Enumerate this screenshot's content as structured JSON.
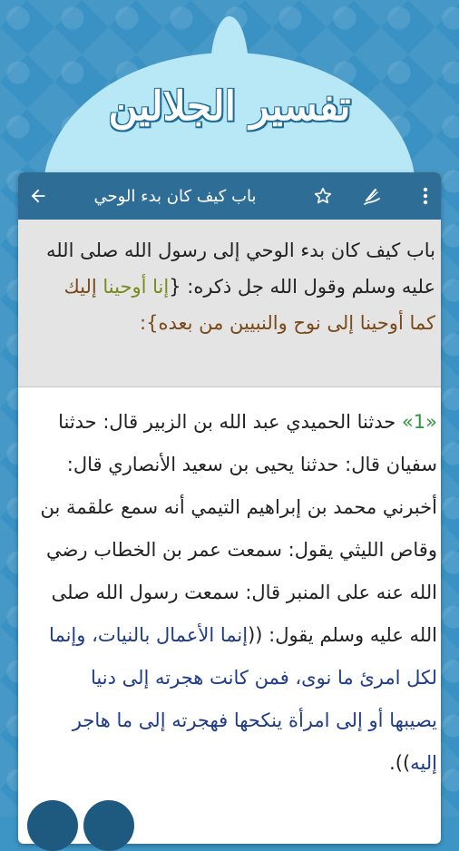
{
  "app": {
    "logo_text": "تفسير الجلالين"
  },
  "toolbar": {
    "title": "باب كيف كان بدء الوحي",
    "icons": [
      "back-arrow-icon",
      "star-icon",
      "pen-icon",
      "more-vert-icon"
    ]
  },
  "chapter_header": {
    "part1": "باب كيف كان بدء الوحي إلى رسول الله صلى الله عليه وسلم وقول الله جل ذكره: {",
    "part2": "إنا أوحينا",
    "part3": " إليك كما أوحينا إلى نوح والنبيين من بعده}:"
  },
  "hadith": {
    "number": "«1»",
    "narration": " حدثنا الحميدي عبد الله بن الزبير قال: حدثنا سفيان قال: حدثنا يحيى بن سعيد الأنصاري قال: أخبرني محمد بن إبراهيم التيمي أنه سمع علقمة بن وقاص الليثي يقول: سمعت عمر بن الخطاب رضي الله عنه على المنبر قال: سمعت رسول الله صلى الله عليه وسلم يقول: ((",
    "quote": "إنما الأعمال بالنيات، وإنما لكل امرئ ما نوى، فمن كانت هجرته إلى دنيا يصيبها أو إلى امرأة ينكحها فهجرته إلى ما هاجر إليه",
    "closing": ")).",
    "colors": {
      "number": "#2c9a3a",
      "quote": "#1f3b8a"
    }
  },
  "colors": {
    "background": "#3d95c6",
    "dome": "#b8e8f6",
    "toolbar": "#2e6e96",
    "header_box": "#e4e4e4"
  }
}
